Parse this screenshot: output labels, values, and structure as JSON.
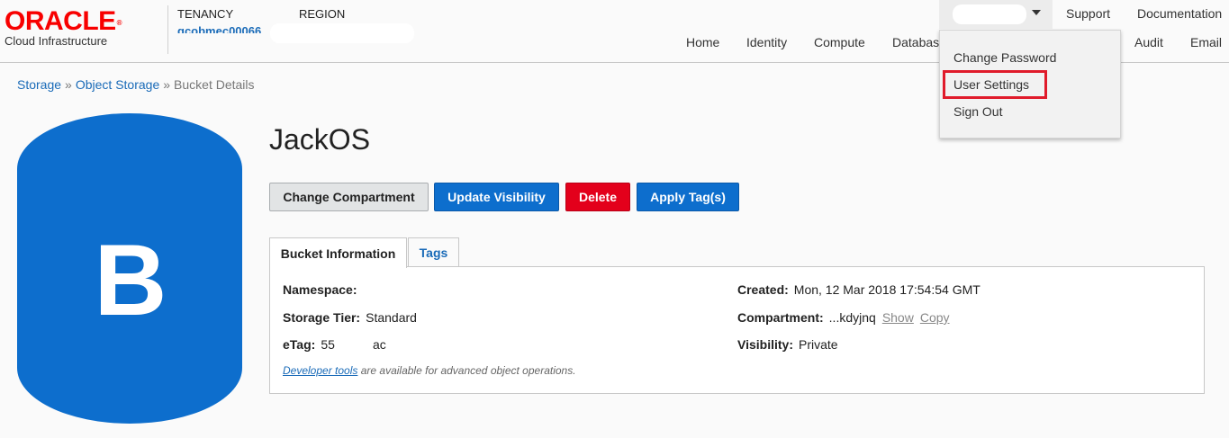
{
  "header": {
    "logo": "ORACLE",
    "logo_sub": "Cloud Infrastructure",
    "tenancy_label": "TENANCY",
    "tenancy_value": "gcobmec00066",
    "region_label": "REGION",
    "top_links": {
      "support": "Support",
      "documentation": "Documentation"
    },
    "nav": [
      "Home",
      "Identity",
      "Compute",
      "Databas",
      "Audit",
      "Email"
    ]
  },
  "user_menu": {
    "items": [
      "Change Password",
      "User Settings",
      "Sign Out"
    ],
    "highlighted": "User Settings"
  },
  "breadcrumb": {
    "storage": "Storage",
    "object_storage": "Object Storage",
    "current": "Bucket Details",
    "separator": "»"
  },
  "bucket": {
    "letter": "B",
    "name": "JackOS",
    "icon_color": "#0d6ecd"
  },
  "actions": {
    "change_compartment": "Change Compartment",
    "update_visibility": "Update Visibility",
    "delete": "Delete",
    "apply_tags": "Apply Tag(s)"
  },
  "tabs": {
    "info": "Bucket Information",
    "tags": "Tags"
  },
  "info": {
    "namespace_label": "Namespace:",
    "storage_tier_label": "Storage Tier:",
    "storage_tier_value": "Standard",
    "etag_label": "eTag:",
    "etag_value": "55",
    "etag_value_2": "ac",
    "created_label": "Created:",
    "created_value": "Mon, 12 Mar 2018 17:54:54 GMT",
    "compartment_label": "Compartment:",
    "compartment_value": "...kdyjnq",
    "show_link": "Show",
    "copy_link": "Copy",
    "visibility_label": "Visibility:",
    "visibility_value": "Private",
    "dev_tools_link": "Developer tools",
    "dev_tools_text": " are available for advanced object operations."
  },
  "colors": {
    "oracle_red": "#f80000",
    "link_blue": "#1a6bb8",
    "primary_button": "#0d6ecd",
    "danger_button": "#e3001b",
    "highlight_box": "#e01b2b"
  }
}
